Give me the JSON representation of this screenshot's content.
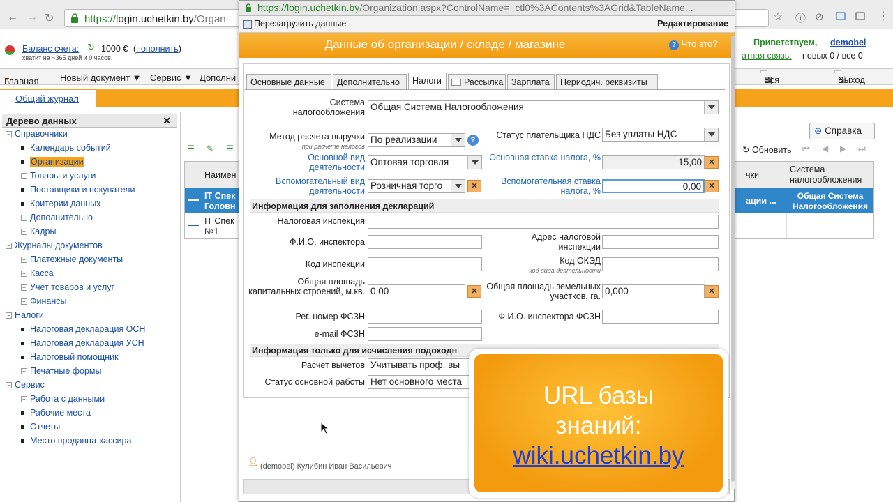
{
  "browser": {
    "url_secure": "https://",
    "url_host": "login.uchetkin.by",
    "url_rest": "/Organ"
  },
  "page": {
    "balance_label": "Баланс счета:",
    "balance_amount": "1000 €",
    "balance_topup": "пополнить",
    "balance_note": "хватит на ~365 дней и 0 часов.",
    "greeting": "Приветствуем,",
    "username": "demobel",
    "feedback_link": "атная связь:",
    "feedback_counts": "новых 0 / все  0",
    "menu": [
      "Главная",
      "Новый документ ▼",
      "Сервис ▼",
      "Дополни"
    ],
    "all_help": "Вся справка",
    "logout": "Выход",
    "journal_tab": "Общий журнал",
    "tree_title": "Дерево данных",
    "help_button": "Справка",
    "refresh_button": "Обновить",
    "grid_header_name": "Наимен",
    "grid_header_right1": "чки",
    "grid_header_right2": "Система налогообложения",
    "grid_row1_name": "IT Спек Головн",
    "grid_row1_right1": "ации ...",
    "grid_row1_right2": "Общая Система Налогообложения",
    "grid_row2_name": "IT Спек №1"
  },
  "tree": [
    {
      "label": "Справочники",
      "kind": "minus"
    },
    {
      "label": "Календарь событий",
      "kind": "bullet"
    },
    {
      "label": "Организации",
      "kind": "bullet",
      "selected": true
    },
    {
      "label": "Товары и услуги",
      "kind": "plus"
    },
    {
      "label": "Поставщики и покупатели",
      "kind": "bullet"
    },
    {
      "label": "Критерии данных",
      "kind": "bullet"
    },
    {
      "label": "Дополнительно",
      "kind": "plus"
    },
    {
      "label": "Кадры",
      "kind": "plus"
    },
    {
      "label": "Журналы документов",
      "kind": "minus"
    },
    {
      "label": "Платежные документы",
      "kind": "plus"
    },
    {
      "label": "Касса",
      "kind": "plus"
    },
    {
      "label": "Учет товаров и услуг",
      "kind": "plus"
    },
    {
      "label": "Финансы",
      "kind": "plus"
    },
    {
      "label": "Налоги",
      "kind": "minus"
    },
    {
      "label": "Налоговая декларация ОСН",
      "kind": "bullet"
    },
    {
      "label": "Налоговая декларация УСН",
      "kind": "bullet"
    },
    {
      "label": "Налоговый помощник",
      "kind": "bullet"
    },
    {
      "label": "Печатные формы",
      "kind": "plus"
    },
    {
      "label": "Сервис",
      "kind": "minus"
    },
    {
      "label": "Работа с данными",
      "kind": "plus"
    },
    {
      "label": "Рабочие места",
      "kind": "bullet"
    },
    {
      "label": "Отчеты",
      "kind": "bullet"
    },
    {
      "label": "Место продавца-кассира",
      "kind": "bullet"
    }
  ],
  "modal": {
    "url_host": "https://login.uchetkin.by",
    "url_rest": "/Organization.aspx?ControlName=_ctl0%3AContents%3AGrid&TableName...",
    "reload": "Перезагрузить данные",
    "mode": "Редактирование",
    "title": "Данные об организации / складе / магазине",
    "whats_this": "Что это?",
    "tabs": [
      "Основные данные",
      "Дополнительно",
      "Налоги",
      "Рассылка",
      "Зарплата",
      "Периодич. реквизиты"
    ],
    "form": {
      "tax_system_label": "Система налогообложения",
      "tax_system_value": "Общая Система Налогообложения",
      "revenue_method_label": "Метод расчета выручки",
      "revenue_method_sub": "при расчете налогов",
      "revenue_method_value": "По реализации",
      "vat_status_label": "Статус плательщика НДС",
      "vat_status_value": "Без уплаты НДС",
      "main_activity_label": "Основной вид деятельности",
      "main_activity_value": "Оптовая торговля",
      "main_rate_label": "Основная ставка  налога, %",
      "main_rate_value": "15,00",
      "aux_activity_label": "Вспомогательный вид деятельности",
      "aux_activity_value": "Розничная торго",
      "aux_rate_label": "Вспомогательная ставка налога, %",
      "aux_rate_value": "0,00",
      "section_declaration": "Информация для заполнения деклараций",
      "tax_office_label": "Налоговая инспекция",
      "inspector_name_label": "Ф.И.О.  инспектора",
      "tax_office_address_label": "Адрес налоговой инспекции",
      "inspection_code_label": "Код инспекции",
      "okved_label": "Код ОКЭД",
      "okved_sub": "код вида деятельности",
      "capital_area_label": "Общая площадь капитальных строений, м.кв.",
      "capital_area_value": "0,00",
      "land_area_label": "Общая площадь земельных участков, га.",
      "land_area_value": "0,000",
      "fszn_reg_label": "Рег. номер ФСЗН",
      "fszn_inspector_label": "Ф.И.О. инспектора ФСЗН",
      "fszn_email_label": "e-mail ФСЗН",
      "section_income": "Информация только для исчисления подоходн",
      "deduction_label": "Расчет вычетов",
      "deduction_value": "Учитывать проф. вы",
      "main_job_label": "Статус основной работы",
      "main_job_value": "Нет основного места"
    },
    "footer_user": "(demobel) Кулибин Иван Васильевич"
  },
  "banner": {
    "line1": "URL базы",
    "line2": "знаний:",
    "url": "wiki.uchetkin.by"
  },
  "colors": {
    "accent_orange": "#f6a21b",
    "link_blue": "#1a4fa0",
    "grid_selected": "#2f86c8"
  }
}
